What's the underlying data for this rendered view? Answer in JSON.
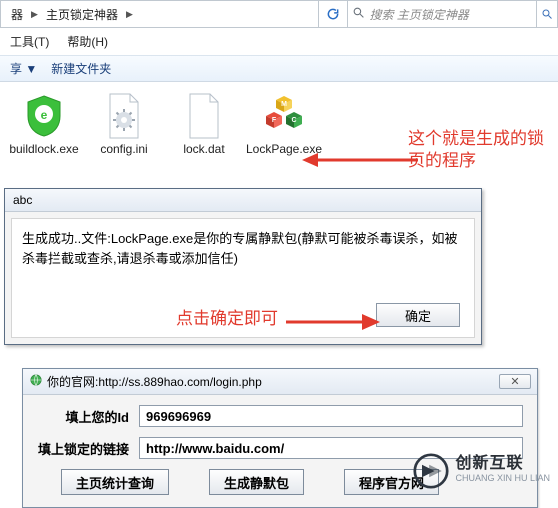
{
  "breadcrumb": {
    "seg1": "器",
    "seg2": "主页锁定神器"
  },
  "search": {
    "placeholder": "搜索 主页锁定神器"
  },
  "menu": {
    "tools": "工具(T)",
    "help": "帮助(H)"
  },
  "toolbar": {
    "share": "享 ▼",
    "newfolder": "新建文件夹"
  },
  "files": [
    {
      "name": "buildlock.exe",
      "icon": "shield-e"
    },
    {
      "name": "config.ini",
      "icon": "gear-file"
    },
    {
      "name": "lock.dat",
      "icon": "blank-file"
    },
    {
      "name": "LockPage.exe",
      "icon": "mfc-cubes"
    }
  ],
  "anno1_line1": "这个就是生成的锁",
  "anno1_line2": "页的程序",
  "dialog": {
    "title": "abc",
    "body": "生成成功..文件:LockPage.exe是你的专属静默包(静默可能被杀毒误杀，如被杀毒拦截或查杀,请退杀毒或添加信任)",
    "ok": "确定"
  },
  "anno2": "点击确定即可",
  "panel": {
    "title": "你的官网:http://ss.889hao.com/login.php",
    "close": "✕",
    "field1_label": "填上您的Id",
    "field1_value": "969696969",
    "field2_label": "填上锁定的链接",
    "field2_value": "http://www.baidu.com/",
    "btn1": "主页统计查询",
    "btn2": "生成静默包",
    "btn3": "程序官方网"
  },
  "watermark": {
    "cn": "创新互联",
    "en": "CHUANG XIN HU LIAN"
  }
}
